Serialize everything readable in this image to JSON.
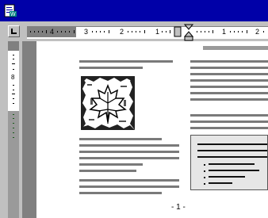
{
  "app": {
    "icon": "word-document-icon"
  },
  "ruler": {
    "labels": [
      "4",
      "3",
      "2",
      "1",
      "1",
      "2"
    ]
  },
  "page": {
    "page_number": "- 1 -"
  },
  "colors": {
    "title_bar": "#0000a8",
    "chrome": "#c0c0c0",
    "text_line": "#7a7a7a"
  }
}
